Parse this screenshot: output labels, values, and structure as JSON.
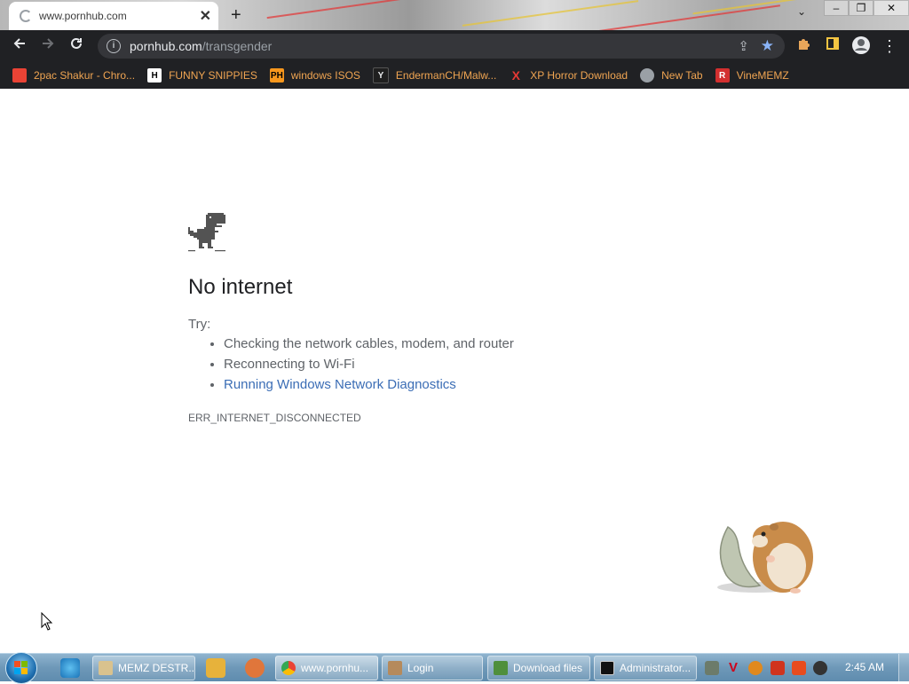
{
  "browser": {
    "tab_title": "www.pornhub.com",
    "tab_close": "✕",
    "new_tab": "+",
    "window_controls": [
      "–",
      "❐",
      "✕"
    ],
    "address_host": "pornhub.com",
    "address_path": "/transgender"
  },
  "bookmarks": [
    {
      "label": "2pac Shakur - Chro...",
      "icon": "chrome-web-store-icon",
      "color": "#ea4335"
    },
    {
      "label": "FUNNY SNIPPIES",
      "icon": "h-letter-icon",
      "glyph": "H",
      "color": "#ffffff"
    },
    {
      "label": "windows ISOS",
      "icon": "ph-icon",
      "glyph": "PH",
      "color": "#f7971d"
    },
    {
      "label": "EndermanCH/Malw...",
      "icon": "yp-icon",
      "glyph": "Y",
      "color": "#1f1f1f"
    },
    {
      "label": "XP Horror Download",
      "icon": "x-icon",
      "glyph": "X",
      "color": "#e53935"
    },
    {
      "label": "New Tab",
      "icon": "globe-icon",
      "color": "#9aa0a6"
    },
    {
      "label": "VineMEMZ",
      "icon": "r-letter-icon",
      "glyph": "R",
      "color": "#d32f2f"
    }
  ],
  "error_page": {
    "heading": "No internet",
    "try_label": "Try:",
    "suggestions": [
      "Checking the network cables, modem, and router",
      "Reconnecting to Wi-Fi"
    ],
    "diagnostics_link": "Running Windows Network Diagnostics",
    "error_code": "ERR_INTERNET_DISCONNECTED"
  },
  "taskbar": {
    "tasks": [
      {
        "label": "MEMZ DESTR...",
        "icon": "memz-icon"
      },
      {
        "label": "www.pornhu...",
        "icon": "chrome-icon"
      },
      {
        "label": "Login",
        "icon": "login-icon"
      },
      {
        "label": "Download files",
        "icon": "download-icon"
      },
      {
        "label": "Administrator...",
        "icon": "cmd-icon"
      }
    ],
    "clock": "2:45 AM"
  },
  "colors": {
    "toolbar_bg": "#202124",
    "bookmark_text": "#f0a552",
    "link": "#3b6db5",
    "taskbar": "#6e98b8"
  }
}
